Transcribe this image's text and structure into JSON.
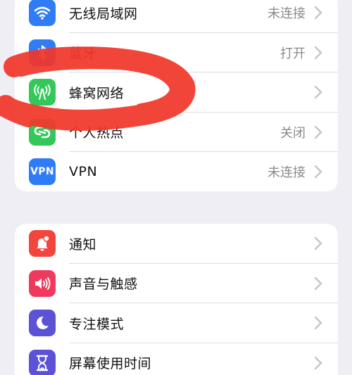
{
  "network_group": {
    "items": [
      {
        "name": "wifi",
        "label": "无线局域网",
        "value": "未连接",
        "icon": "wifi-icon",
        "color": "#2f7cf6"
      },
      {
        "name": "bluetooth",
        "label": "蓝牙",
        "value": "打开",
        "icon": "bluetooth-icon",
        "color": "#2f7cf6"
      },
      {
        "name": "cellular",
        "label": "蜂窝网络",
        "value": "",
        "icon": "cellular-antenna-icon",
        "color": "#34c759"
      },
      {
        "name": "hotspot",
        "label": "个人热点",
        "value": "关闭",
        "icon": "hotspot-icon",
        "color": "#34c759"
      },
      {
        "name": "vpn",
        "label": "VPN",
        "value": "未连接",
        "icon": "vpn-icon",
        "icon_text": "VPN",
        "color": "#2f7cf6"
      }
    ]
  },
  "system_group": {
    "items": [
      {
        "name": "notifications",
        "label": "通知",
        "icon": "notification-bell-icon",
        "color": "#f1453d"
      },
      {
        "name": "sounds",
        "label": "声音与触感",
        "icon": "speaker-icon",
        "color": "#ee3a5d"
      },
      {
        "name": "focus",
        "label": "专注模式",
        "icon": "moon-icon",
        "color": "#5b52d6"
      },
      {
        "name": "screen-time",
        "label": "屏幕使用时间",
        "icon": "hourglass-icon",
        "color": "#5b52d6"
      }
    ]
  },
  "annotation": {
    "color": "#f2372b"
  }
}
